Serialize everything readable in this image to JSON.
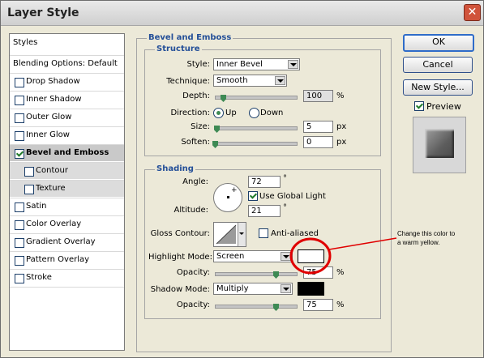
{
  "window": {
    "title": "Layer Style",
    "close_symbol": "✕"
  },
  "sidebar": {
    "items": [
      {
        "label": "Styles",
        "checkbox": false,
        "checked": false,
        "selected": false
      },
      {
        "label": "Blending Options: Default",
        "checkbox": false,
        "checked": false,
        "selected": false
      },
      {
        "label": "Drop Shadow",
        "checkbox": true,
        "checked": false,
        "selected": false
      },
      {
        "label": "Inner Shadow",
        "checkbox": true,
        "checked": false,
        "selected": false
      },
      {
        "label": "Outer Glow",
        "checkbox": true,
        "checked": false,
        "selected": false
      },
      {
        "label": "Inner Glow",
        "checkbox": true,
        "checked": false,
        "selected": false
      },
      {
        "label": "Bevel and Emboss",
        "checkbox": true,
        "checked": true,
        "selected": true
      },
      {
        "label": "Contour",
        "checkbox": true,
        "checked": false,
        "selected": false,
        "sub": true
      },
      {
        "label": "Texture",
        "checkbox": true,
        "checked": false,
        "selected": false,
        "sub": true
      },
      {
        "label": "Satin",
        "checkbox": true,
        "checked": false,
        "selected": false
      },
      {
        "label": "Color Overlay",
        "checkbox": true,
        "checked": false,
        "selected": false
      },
      {
        "label": "Gradient Overlay",
        "checkbox": true,
        "checked": false,
        "selected": false
      },
      {
        "label": "Pattern Overlay",
        "checkbox": true,
        "checked": false,
        "selected": false
      },
      {
        "label": "Stroke",
        "checkbox": true,
        "checked": false,
        "selected": false
      }
    ]
  },
  "panel": {
    "title": "Bevel and Emboss"
  },
  "structure": {
    "legend": "Structure",
    "style_label": "Style:",
    "style_value": "Inner Bevel",
    "technique_label": "Technique:",
    "technique_value": "Smooth",
    "depth_label": "Depth:",
    "depth_value": "100",
    "depth_unit": "%",
    "depth_level": 0.1,
    "direction_label": "Direction:",
    "direction_up": "Up",
    "direction_down": "Down",
    "direction_selected": "Up",
    "size_label": "Size:",
    "size_value": "5",
    "size_unit": "px",
    "size_level": 0.02,
    "soften_label": "Soften:",
    "soften_value": "0",
    "soften_unit": "px",
    "soften_level": 0.0
  },
  "shading": {
    "legend": "Shading",
    "angle_label": "Angle:",
    "angle_value": "72",
    "angle_unit": "°",
    "use_global_light_label": "Use Global Light",
    "use_global_light_checked": true,
    "altitude_label": "Altitude:",
    "altitude_value": "21",
    "altitude_unit": "°",
    "gloss_contour_label": "Gloss Contour:",
    "anti_aliased_label": "Anti-aliased",
    "anti_aliased_checked": false,
    "highlight_mode_label": "Highlight Mode:",
    "highlight_mode_value": "Screen",
    "highlight_color": "#ffffff",
    "highlight_opacity_label": "Opacity:",
    "highlight_opacity_value": "75",
    "highlight_opacity_unit": "%",
    "highlight_opacity_level": 0.75,
    "shadow_mode_label": "Shadow Mode:",
    "shadow_mode_value": "Multiply",
    "shadow_color": "#000000",
    "shadow_opacity_label": "Opacity:",
    "shadow_opacity_value": "75",
    "shadow_opacity_unit": "%",
    "shadow_opacity_level": 0.75
  },
  "buttons": {
    "ok": "OK",
    "cancel": "Cancel",
    "new_style": "New Style..."
  },
  "preview": {
    "label": "Preview",
    "checked": true
  },
  "annotation": {
    "line1": "Change this color to",
    "line2": "a warm yellow.",
    "color": "#e00000"
  }
}
